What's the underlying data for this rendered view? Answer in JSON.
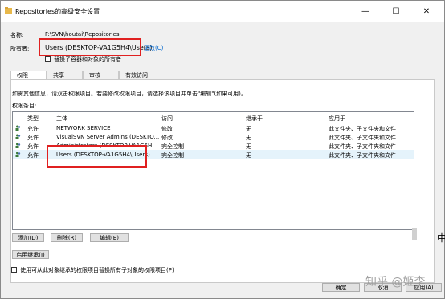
{
  "window": {
    "title": "Repositories的高级安全设置",
    "minimize_glyph": "—",
    "maximize_glyph": "☐",
    "close_glyph": "✕"
  },
  "header": {
    "name_label": "名称:",
    "name_value": "F:\\SVN\\houtai\\Repositories",
    "owner_label": "所有者:",
    "owner_value": "Users (DESKTOP-VA1G5H4\\Users)",
    "owner_change_link": "更改(C)",
    "replace_owner_checkbox_label": "替换子容器和对象的所有者"
  },
  "tabs": [
    {
      "label": "权限",
      "active": true
    },
    {
      "label": "共享",
      "active": false
    },
    {
      "label": "审核",
      "active": false
    },
    {
      "label": "有效访问",
      "active": false
    }
  ],
  "permissions": {
    "info_text": "如需其他信息，请双击权限项目。若要修改权限项目，请选择该项目并单击\"编辑\"(如果可用)。",
    "entries_label": "权限条目:",
    "columns": [
      "类型",
      "主体",
      "访问",
      "继承于",
      "应用于"
    ],
    "rows": [
      {
        "type": "允许",
        "principal": "NETWORK SERVICE",
        "access": "修改",
        "inherited": "无",
        "applies": "此文件夹、子文件夹和文件",
        "selected": false
      },
      {
        "type": "允许",
        "principal": "VisualSVN Server Admins (DESKTO...",
        "access": "修改",
        "inherited": "无",
        "applies": "此文件夹、子文件夹和文件",
        "selected": false
      },
      {
        "type": "允许",
        "principal": "Administrators (DESKTOP-VA1G5H...",
        "access": "完全控制",
        "inherited": "无",
        "applies": "此文件夹、子文件夹和文件",
        "selected": false
      },
      {
        "type": "允许",
        "principal": "Users (DESKTOP-VA1G5H4\\Users)",
        "access": "完全控制",
        "inherited": "无",
        "applies": "此文件夹、子文件夹和文件",
        "selected": true
      }
    ]
  },
  "buttons": {
    "add": "添加(D)",
    "remove": "删除(R)",
    "edit": "编辑(E)",
    "enable_inheritance": "启用继承(I)",
    "ok": "确定",
    "cancel": "取消",
    "apply": "应用(A)"
  },
  "replace_child_checkbox_label": "使用可从此对象继承的权限项目替换所有子对象的权限项目(P)",
  "watermark": "知乎 @姬李",
  "side_char": "中",
  "colors": {
    "highlight_box": "#e02020",
    "link": "#0066cc",
    "selected_row": "#e5f3fb"
  }
}
